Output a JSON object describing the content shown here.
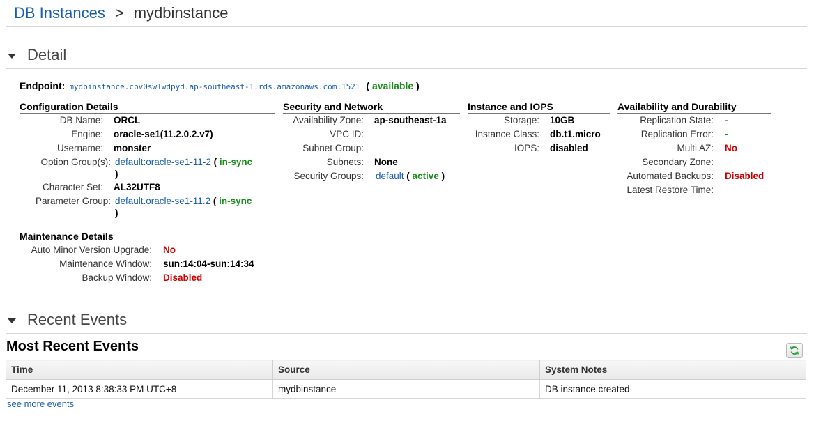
{
  "breadcrumb": {
    "parent": "DB Instances",
    "separator": ">",
    "current": "mydbinstance"
  },
  "sections": {
    "detail": "Detail",
    "recent_events": "Recent Events"
  },
  "endpoint": {
    "label": "Endpoint:",
    "value": "mydbinstance.cbv0sw1wdpyd.ap-southeast-1.rds.amazonaws.com:1521",
    "status": "available"
  },
  "config": {
    "title": "Configuration Details",
    "db_name_label": "DB Name:",
    "db_name": "ORCL",
    "engine_label": "Engine:",
    "engine": "oracle-se1(11.2.0.2.v7)",
    "username_label": "Username:",
    "username": "monster",
    "option_group_label": "Option Group(s):",
    "option_group": "default:oracle-se1-11-2",
    "option_group_status": "in-sync",
    "charset_label": "Character Set:",
    "charset": "AL32UTF8",
    "param_group_label": "Parameter Group:",
    "param_group": "default.oracle-se1-11.2",
    "param_group_status": "in-sync"
  },
  "security": {
    "title": "Security and Network",
    "az_label": "Availability Zone:",
    "az": "ap-southeast-1a",
    "vpc_label": "VPC ID:",
    "subnet_group_label": "Subnet Group:",
    "subnets_label": "Subnets:",
    "subnets": "None",
    "sg_label": "Security Groups:",
    "sg": "default",
    "sg_status": "active"
  },
  "instance": {
    "title": "Instance and IOPS",
    "storage_label": "Storage:",
    "storage": "10GB",
    "class_label": "Instance Class:",
    "class": "db.t1.micro",
    "iops_label": "IOPS:",
    "iops": "disabled"
  },
  "availability": {
    "title": "Availability and Durability",
    "rep_state_label": "Replication State:",
    "rep_state": "-",
    "rep_error_label": "Replication Error:",
    "rep_error": "-",
    "multi_az_label": "Multi AZ:",
    "multi_az": "No",
    "secondary_zone_label": "Secondary Zone:",
    "auto_backups_label": "Automated Backups:",
    "auto_backups": "Disabled",
    "latest_restore_label": "Latest Restore Time:"
  },
  "maintenance": {
    "title": "Maintenance Details",
    "auto_minor_label": "Auto Minor Version Upgrade:",
    "auto_minor": "No",
    "window_label": "Maintenance Window:",
    "window": "sun:14:04-sun:14:34",
    "backup_window_label": "Backup Window:",
    "backup_window": "Disabled"
  },
  "events": {
    "title": "Most Recent Events",
    "columns": [
      "Time",
      "Source",
      "System Notes"
    ],
    "rows": [
      [
        "December 11, 2013 8:38:33 PM UTC+8",
        "mydbinstance",
        "DB instance created"
      ]
    ],
    "see_more": "see more events"
  },
  "colors": {
    "link": "#1a5fae",
    "ok": "#1d8e1d",
    "bad": "#cc0000"
  },
  "icons": {
    "refresh": "refresh-icon",
    "collapse": "caret-down-icon"
  }
}
